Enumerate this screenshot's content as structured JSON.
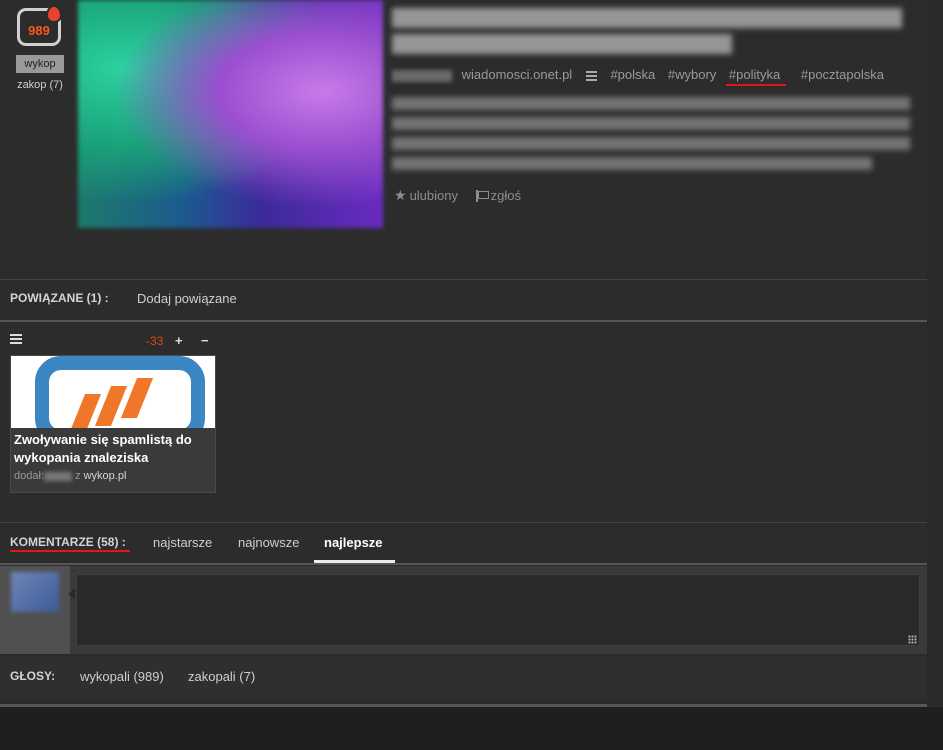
{
  "entry": {
    "vote_count": "989",
    "wykop_label": "wykop",
    "zakop_label": "zakop (7)",
    "source": "wiadomosci.onet.pl",
    "tags": [
      "#polska",
      "#wybory",
      "#polityka",
      "#pocztapolska"
    ],
    "favorite_label": "ulubiony",
    "report_label": "zgłoś"
  },
  "related": {
    "label": "POWIĄZANE (1) :",
    "add_label": "Dodaj powiązane",
    "score": "-33",
    "plus": "+",
    "minus": "−",
    "card_title": "Zwoływanie się spamlistą do wykopania znaleziska",
    "card_added": "dodał:",
    "card_from": "z",
    "card_source": "wykop.pl"
  },
  "comments": {
    "label": "KOMENTARZE (58) :",
    "tabs": [
      "najstarsze",
      "najnowsze",
      "najlepsze"
    ],
    "active_tab": "najlepsze"
  },
  "votes": {
    "label": "GŁOSY:",
    "wykopali": "wykopali (989)",
    "zakopali": "zakopali (7)"
  },
  "colors": {
    "accent_red": "#e2141c",
    "vote_orange": "#ff5917",
    "score_red": "#e2481d"
  }
}
